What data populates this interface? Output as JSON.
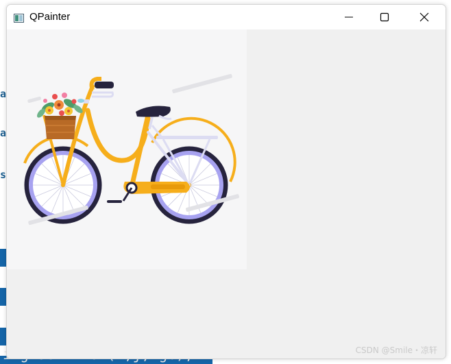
{
  "window": {
    "title": "QPainter",
    "controls": {
      "minimize": "minimize-icon",
      "maximize": "maximize-icon",
      "close": "close-icon"
    }
  },
  "canvas": {
    "image_subject": "bicycle-with-flower-basket",
    "watermark": "CSDN @Smile・凉轩"
  },
  "background_editor": {
    "code_line": "img.setPixel(i,j,rgb);"
  },
  "colors": {
    "frame": "#f6ae1b",
    "wheel_rim": "#a7a2f0",
    "tire": "#26233d",
    "highlight_blue": "#1565a8"
  }
}
